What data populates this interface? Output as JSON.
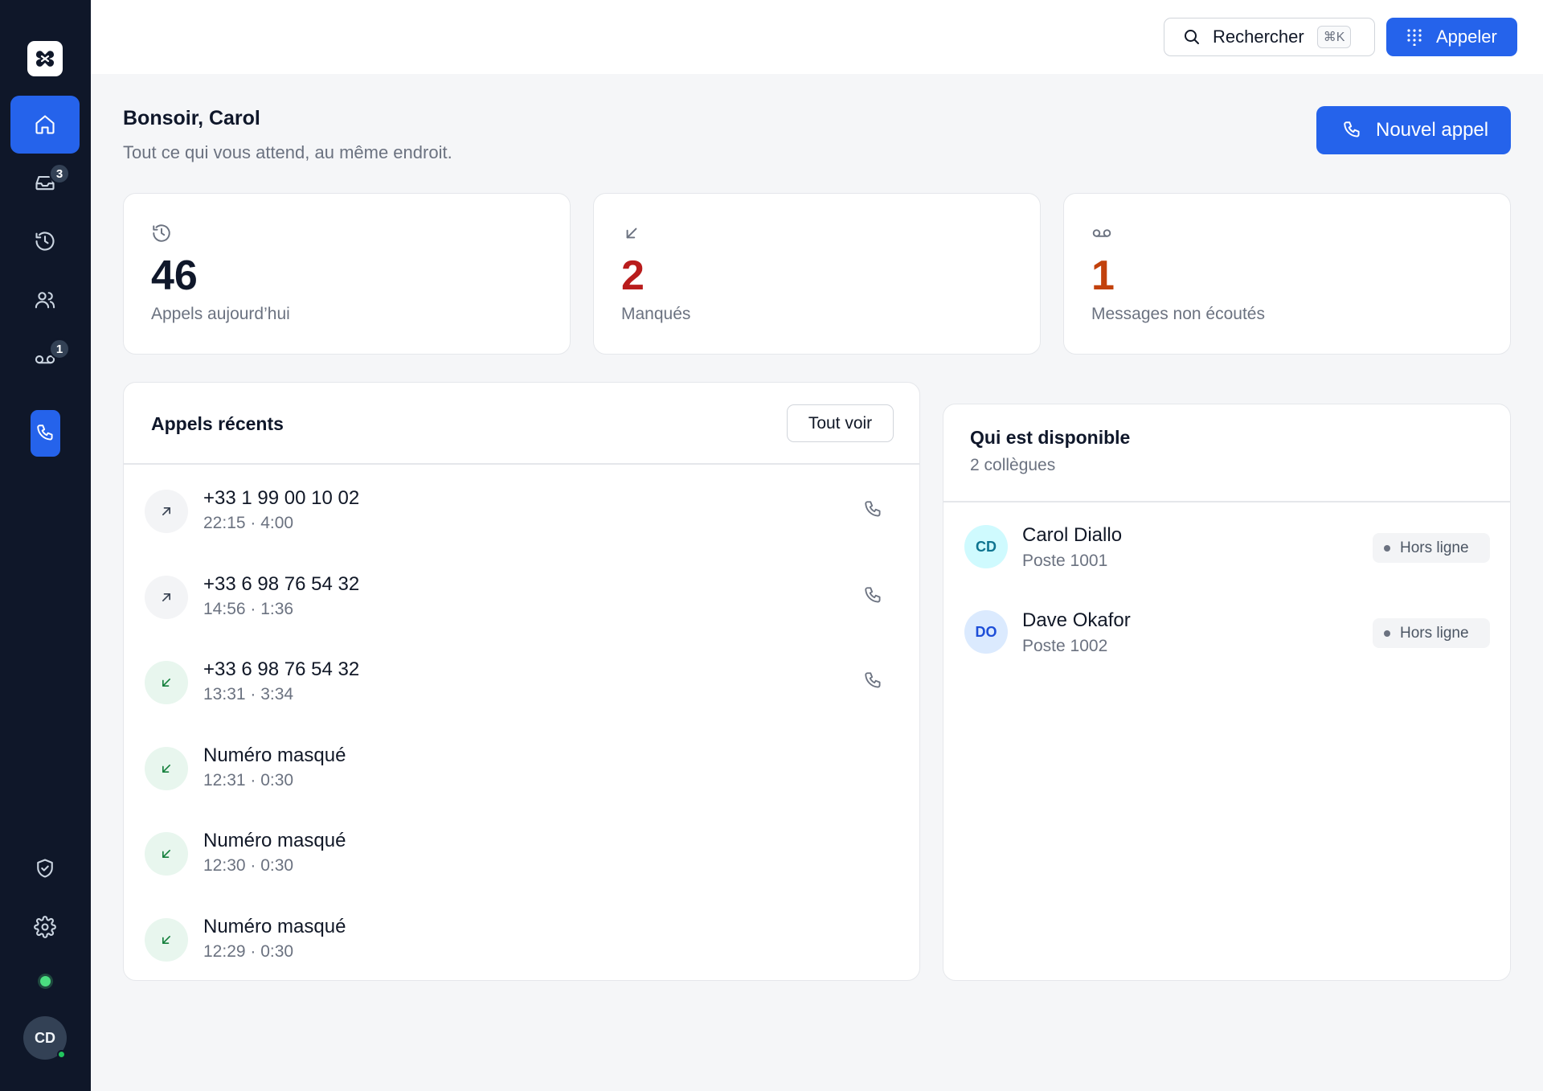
{
  "sidebar": {
    "items": [
      {
        "name": "home",
        "icon": "home-icon",
        "active": true
      },
      {
        "name": "inbox",
        "icon": "inbox-icon",
        "badge": "3"
      },
      {
        "name": "history",
        "icon": "history-icon"
      },
      {
        "name": "contacts",
        "icon": "users-icon"
      },
      {
        "name": "voicemail",
        "icon": "voicemail-icon",
        "badge": "1"
      },
      {
        "name": "dialer",
        "icon": "phone-icon"
      }
    ],
    "bottom_items": [
      {
        "name": "security",
        "icon": "shield-check-icon"
      },
      {
        "name": "settings",
        "icon": "gear-icon"
      }
    ],
    "user_initials": "CD"
  },
  "topbar": {
    "search_label": "Rechercher",
    "search_shortcut": "⌘K",
    "call_label": "Appeler"
  },
  "greeting": {
    "title": "Bonsoir, Carol",
    "subtitle": "Tout ce qui vous attend, au même endroit.",
    "new_call_label": "Nouvel appel"
  },
  "stats": [
    {
      "value": "46",
      "label": "Appels aujourd’hui",
      "icon": "history-icon",
      "color": "#0f172a"
    },
    {
      "value": "2",
      "label": "Manqués",
      "icon": "arrow-down-left-icon",
      "color": "#b91c1c"
    },
    {
      "value": "1",
      "label": "Messages non écoutés",
      "icon": "voicemail-icon",
      "color": "#c2410c"
    }
  ],
  "recent_calls": {
    "title": "Appels récents",
    "see_all_label": "Tout voir",
    "items": [
      {
        "number": "+33 1 99 00 10 02",
        "meta": "22:15 · 4:00",
        "direction": "outgoing",
        "callback": true
      },
      {
        "number": "+33 6 98 76 54 32",
        "meta": "14:56 · 1:36",
        "direction": "outgoing",
        "callback": true
      },
      {
        "number": "+33 6 98 76 54 32",
        "meta": "13:31 · 3:34",
        "direction": "incoming",
        "callback": true
      },
      {
        "number": "Numéro masqué",
        "meta": "12:31 · 0:30",
        "direction": "incoming",
        "callback": false
      },
      {
        "number": "Numéro masqué",
        "meta": "12:30 · 0:30",
        "direction": "incoming",
        "callback": false
      },
      {
        "number": "Numéro masqué",
        "meta": "12:29 · 0:30",
        "direction": "incoming",
        "callback": false
      }
    ]
  },
  "availability": {
    "title": "Qui est disponible",
    "subtitle": "2 collègues",
    "members": [
      {
        "initials": "CD",
        "name": "Carol Diallo",
        "extension": "Poste 1001",
        "status": "Hors ligne",
        "avatar_bg": "#cffafe",
        "avatar_fg": "#0e7490"
      },
      {
        "initials": "DO",
        "name": "Dave Okafor",
        "extension": "Poste 1002",
        "status": "Hors ligne",
        "avatar_bg": "#dbeafe",
        "avatar_fg": "#1d4ed8"
      }
    ]
  },
  "colors": {
    "accent": "#2563eb",
    "sidebar_bg": "#0f1729",
    "missed": "#b91c1c",
    "voicemail": "#c2410c",
    "incoming": "#15803d",
    "online": "#22c55e"
  }
}
